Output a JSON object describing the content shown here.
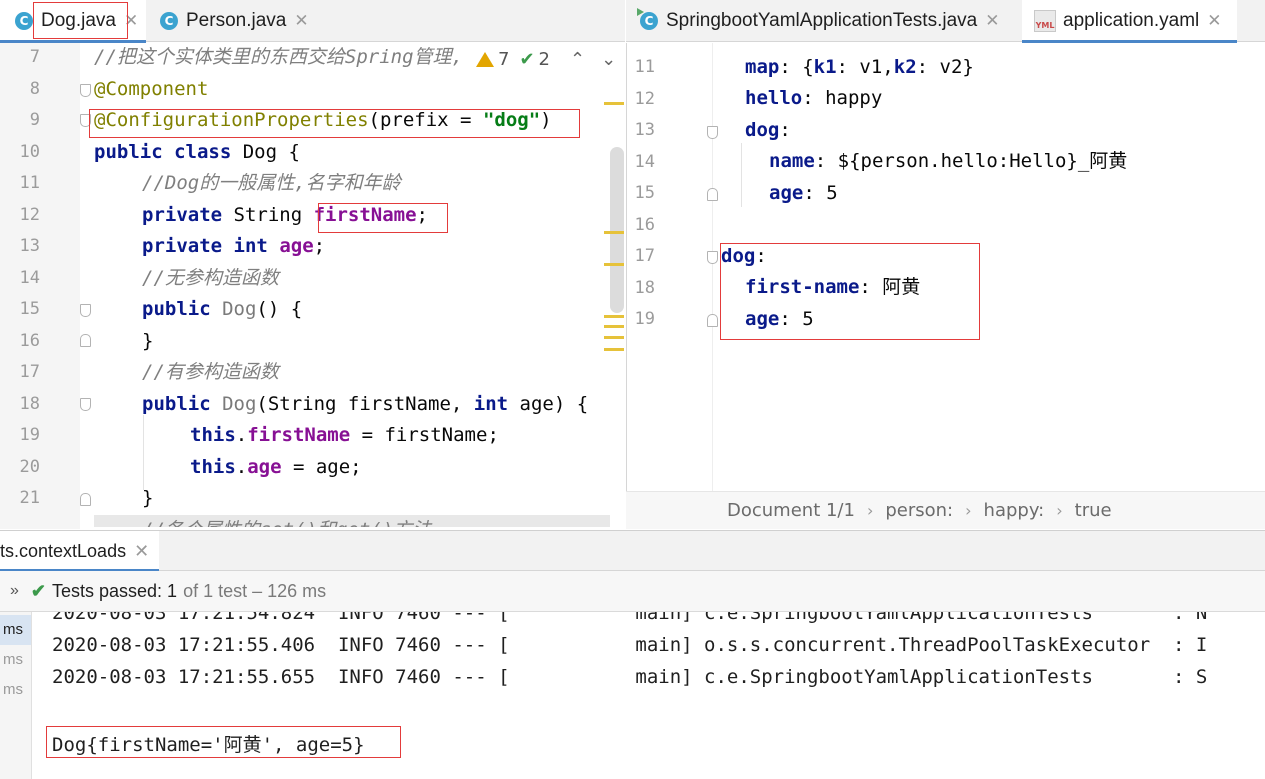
{
  "left_tabs": [
    {
      "label": "Dog.java",
      "close": "✕"
    },
    {
      "label": "Person.java",
      "close": "✕"
    }
  ],
  "right_tabs": [
    {
      "label": "SpringbootYamlApplicationTests.java",
      "close": "✕"
    },
    {
      "label": "application.yaml",
      "close": "✕"
    }
  ],
  "icons": {
    "class_icon_letter": "C",
    "yaml_icon_text": "YML"
  },
  "inspection": {
    "warnings": "7",
    "checks": "2"
  },
  "dog_java": {
    "line_numbers": [
      "7",
      "8",
      "9",
      "10",
      "11",
      "12",
      "13",
      "14",
      "15",
      "16",
      "17",
      "18",
      "19",
      "20",
      "21"
    ],
    "l7_comment": "//把这个实体类里的东西交给Spring管理,",
    "l8_annotation": "@Component",
    "l9_annotation": "@ConfigurationProperties",
    "l9_paren_open": "(prefix = ",
    "l9_value": "\"dog\"",
    "l9_paren_close": ")",
    "l10_public": "public",
    "l10_class": "class",
    "l10_rest": " Dog {",
    "l11_comment": "//Dog的一般属性,名字和年龄",
    "l12_private": "private",
    "l12_type": " String ",
    "l12_field": "firstName",
    "l12_semi": ";",
    "l13_private": "private",
    "l13_int": "int",
    "l13_field": "age",
    "l13_semi": ";",
    "l14_comment": "//无参构造函数",
    "l15_public": "public",
    "l15_name": "Dog",
    "l15_rest": "() {",
    "l16_brace": "}",
    "l17_comment": "//有参构造函数",
    "l18_public": "public",
    "l18_name": "Dog",
    "l18_params": "(String firstName, ",
    "l18_int": "int",
    "l18_rest": " age) {",
    "l19_this": "this",
    "l19_dot": ".",
    "l19_field": "firstName",
    "l19_rest": " = firstName;",
    "l20_this": "this",
    "l20_dot": ".",
    "l20_field": "age",
    "l20_rest": " = age;",
    "l21_brace": "}",
    "l22_comment_partial": "//各个属性的set()和get()方法"
  },
  "yaml": {
    "line_numbers": [
      "11",
      "12",
      "13",
      "14",
      "15",
      "16",
      "17",
      "18",
      "19"
    ],
    "map_key": "map",
    "map_open": ": {",
    "map_k1": "k1",
    "map_mid": ": v1,",
    "map_k2": "k2",
    "map_close": ": v2}",
    "hello_key": "hello",
    "hello_val": ": happy",
    "dog_key_nested": "dog",
    "colon": ":",
    "name_key": "name",
    "name_val": ": ${person.hello:Hello}_阿黄",
    "age_key_nested": "age",
    "age_val_nested": ": 5",
    "dog_key": "dog",
    "first_name_key": "first-name",
    "first_name_val": ": 阿黄",
    "age_key": "age",
    "age_val": ": 5"
  },
  "breadcrumb": [
    "Document 1/1",
    "person:",
    "happy:",
    "true"
  ],
  "breadcrumb_sep": "›",
  "run_tab": {
    "label": "ts.contextLoads",
    "close": "✕"
  },
  "test_status": {
    "chevron": "»",
    "check": "✔",
    "main": "Tests passed: 1",
    "detail": "of 1 test – 126 ms"
  },
  "left_strip": [
    "ms",
    "ms",
    "ms"
  ],
  "console": {
    "partial_line": "2020-08-03 17:21:54.824  INFO 7460 --- [           main] c.e.SpringbootYamlApplicationTests       : N",
    "lines": [
      "2020-08-03 17:21:55.406  INFO 7460 --- [           main] o.s.s.concurrent.ThreadPoolTaskExecutor  : I",
      "2020-08-03 17:21:55.655  INFO 7460 --- [           main] c.e.SpringbootYamlApplicationTests       : S"
    ],
    "result": "Dog{firstName='阿黄', age=5}"
  },
  "colors": {
    "highlight_box": "#e33b3b",
    "keyword": "#0a1a8a",
    "string": "#067d17",
    "field": "#871094",
    "annotation": "#808000",
    "comment": "#7f7f7f",
    "pass": "#3c9a4b"
  }
}
